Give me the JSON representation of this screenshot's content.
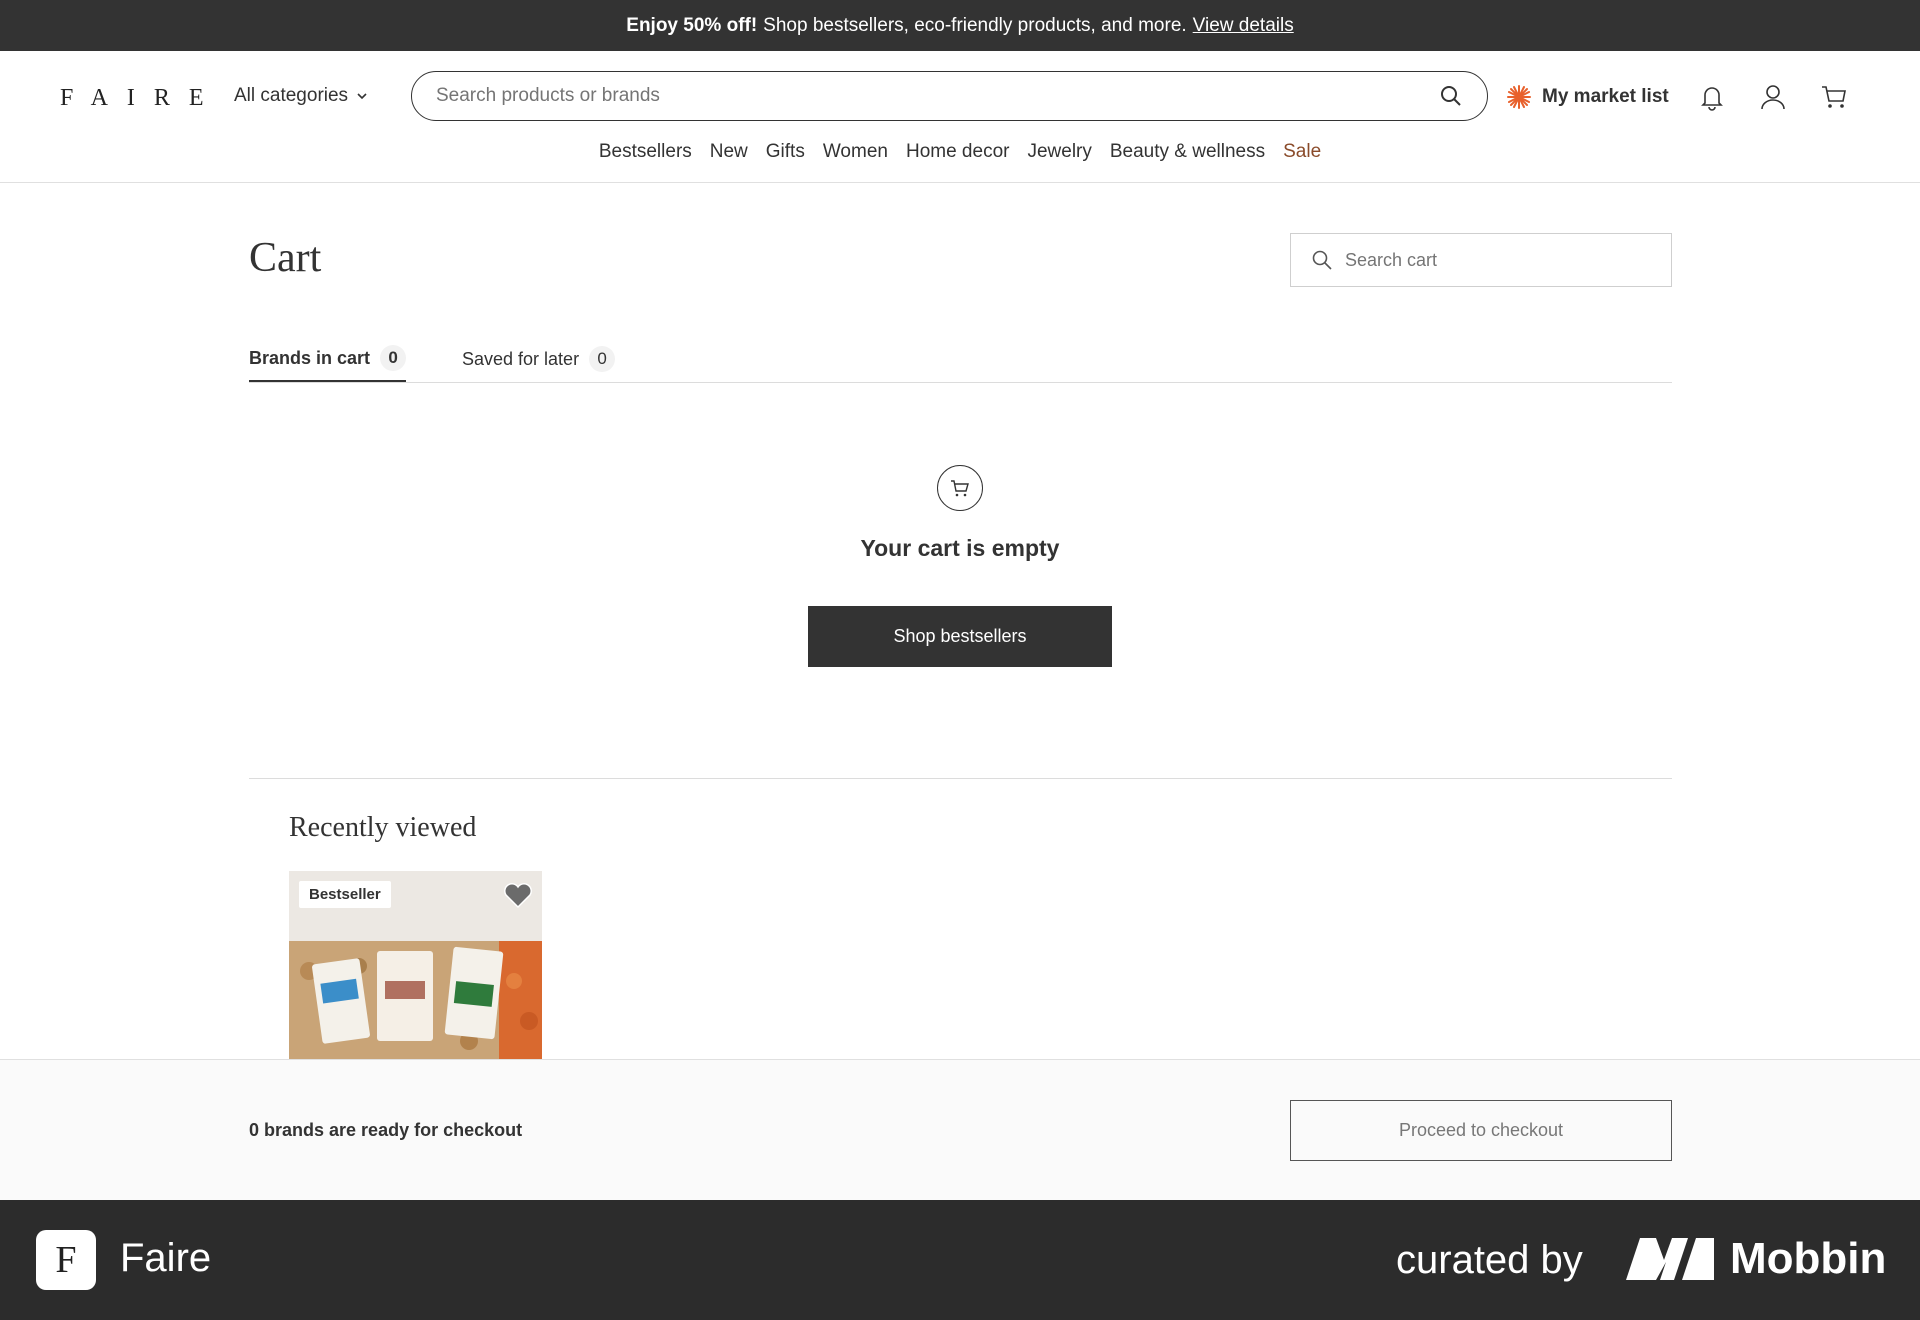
{
  "promo": {
    "bold": "Enjoy 50% off!",
    "text": "Shop bestsellers, eco-friendly products, and more.",
    "link": "View details"
  },
  "header": {
    "logo": "FAIRE",
    "all_categories": "All categories",
    "search_placeholder": "Search products or brands",
    "market_list": "My market list",
    "nav": [
      "Bestsellers",
      "New",
      "Gifts",
      "Women",
      "Home decor",
      "Jewelry",
      "Beauty & wellness",
      "Sale"
    ]
  },
  "cart": {
    "title": "Cart",
    "search_placeholder": "Search cart",
    "tabs": [
      {
        "label": "Brands in cart",
        "count": "0"
      },
      {
        "label": "Saved for later",
        "count": "0"
      }
    ],
    "empty_text": "Your cart is empty",
    "shop_button": "Shop bestsellers"
  },
  "recent": {
    "title": "Recently viewed",
    "product_badge": "Bestseller"
  },
  "checkout": {
    "ready_text": "0 brands are ready for checkout",
    "button": "Proceed to checkout"
  },
  "footer": {
    "app_icon_letter": "F",
    "app_name": "Faire",
    "curated": "curated by",
    "brand": "Mobbin"
  },
  "colors": {
    "dark": "#333333",
    "sale": "#8a4b2a",
    "market_accent": "#e8612c"
  },
  "icons": [
    "chevron-down-icon",
    "search-icon",
    "sun-icon",
    "bell-icon",
    "user-icon",
    "cart-icon",
    "heart-icon"
  ]
}
